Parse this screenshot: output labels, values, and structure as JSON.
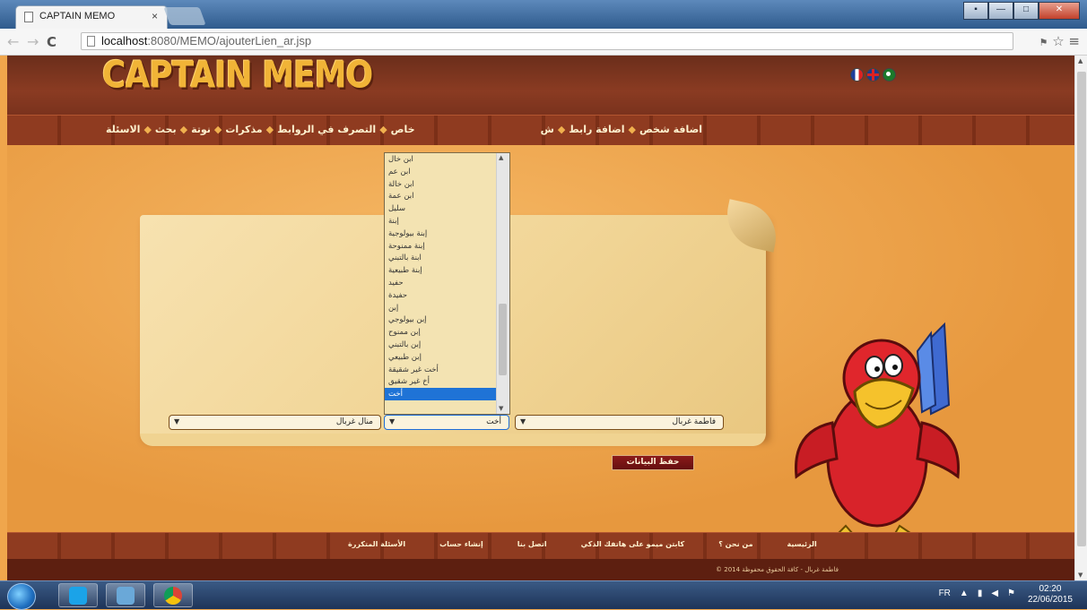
{
  "browser": {
    "tab_title": "CAPTAIN MEMO",
    "tab_close": "×",
    "url_host": "localhost",
    "url_rest": ":8080/MEMO/ajouterLien_ar.jsp"
  },
  "site": {
    "logo": "CAPTAIN MEMO",
    "flags": [
      "fr-flag",
      "uk-flag",
      "ar-flag"
    ],
    "menu_right": [
      "اضافة شخص",
      "اضافة رابط",
      "ش"
    ],
    "menu_left": [
      "الاسئلة",
      "بحث",
      "نوتة",
      "مذكرات",
      "التصرف في الروابط",
      "خاص"
    ]
  },
  "form": {
    "person_left": "منال غربال",
    "relation": "أخت",
    "person_right": "فاطمة غربال",
    "save_label": "حفظ البيانات"
  },
  "dropdown": {
    "items": [
      "ابن خال",
      "ابن عم",
      "ابن خالة",
      "ابن عمة",
      "سليل",
      "إبنة",
      "إبنة بيولوجية",
      "إبنة ممنوحة",
      "ابنة بالتبني",
      "إبنة طبيعية",
      "حفيد",
      "حفيدة",
      "إبن",
      "إبن بيولوجي",
      "إبن ممنوح",
      "إبن بالتبني",
      "إبن طبيعي",
      "أخت غير شقيقة",
      "أخ غير شقيق",
      "أخت"
    ],
    "selected_index": 19
  },
  "footer": {
    "links": [
      "الرئيسية",
      "من نحن ؟",
      "كابتن ميمو على هاتفك الذكي",
      "اتصل بنا",
      "إنشاء حساب",
      "الأسئلة المتكررة"
    ],
    "copyright": "فاطمة غربال - كافة الحقوق محفوظة 2014 ©"
  },
  "taskbar": {
    "lang": "FR",
    "time": "02:20",
    "date": "22/06/2015"
  },
  "colors": {
    "header": "#7a321d",
    "content": "#f1a54d",
    "accent_button": "#8b1a1a",
    "selection": "#1f73d6"
  }
}
